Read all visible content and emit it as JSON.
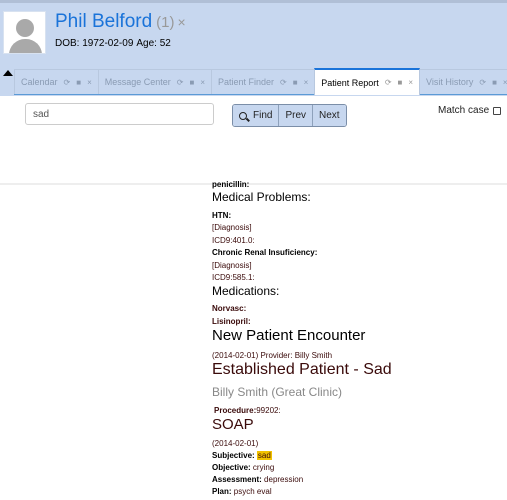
{
  "patient": {
    "name": "Phil Belford",
    "count": "(1)",
    "close_icon": "×",
    "dob_label": "DOB: 1972-02-09",
    "age_label": "Age: 52",
    "avatar": "user-silhouette-icon"
  },
  "tabs": [
    {
      "label": "Calendar",
      "active": false
    },
    {
      "label": "Message Center",
      "active": false
    },
    {
      "label": "Patient Finder",
      "active": false
    },
    {
      "label": "Patient Report",
      "active": true
    },
    {
      "label": "Visit History",
      "active": false
    }
  ],
  "tab_icons": {
    "refresh": "⟳",
    "lock": "🔒",
    "close": "×"
  },
  "find": {
    "search_value": "sad",
    "find_label": "Find",
    "prev_label": "Prev",
    "next_label": "Next",
    "match_case_label": "Match case",
    "match_case_checked": false
  },
  "report": {
    "allergy_cut": "penicillin:",
    "medical_problems_title": "Medical Problems:",
    "problems": [
      {
        "name": "HTN:",
        "type": "[Diagnosis]",
        "code": "ICD9:401.0:"
      },
      {
        "name": "Chronic Renal Insuficiency:",
        "type": "[Diagnosis]",
        "code": "ICD9:585.1:"
      }
    ],
    "medications_title": "Medications:",
    "medications": [
      "Norvasc:",
      "Lisinopril:"
    ],
    "encounter_title": "New Patient Encounter",
    "encounter_meta": "(2014-02-01) Provider: Billy Smith",
    "visit_title": "Established Patient - Sad",
    "visit_provider": "Billy Smith (Great Clinic)",
    "procedure_label": "Procedure:",
    "procedure_code": "99202:",
    "soap_title": "SOAP",
    "soap_date": "(2014-02-01)",
    "soap": [
      {
        "label": "Subjective:",
        "value": "sad",
        "highlighted": true
      },
      {
        "label": "Objective:",
        "value": "crying",
        "highlighted": false
      },
      {
        "label": "Assessment:",
        "value": "depression",
        "highlighted": false
      },
      {
        "label": "Plan:",
        "value": "psych eval",
        "highlighted": false
      }
    ]
  },
  "colors": {
    "header_bg": "#c7d7ef",
    "link_blue": "#1a73d9",
    "highlight": "#f2c200"
  }
}
